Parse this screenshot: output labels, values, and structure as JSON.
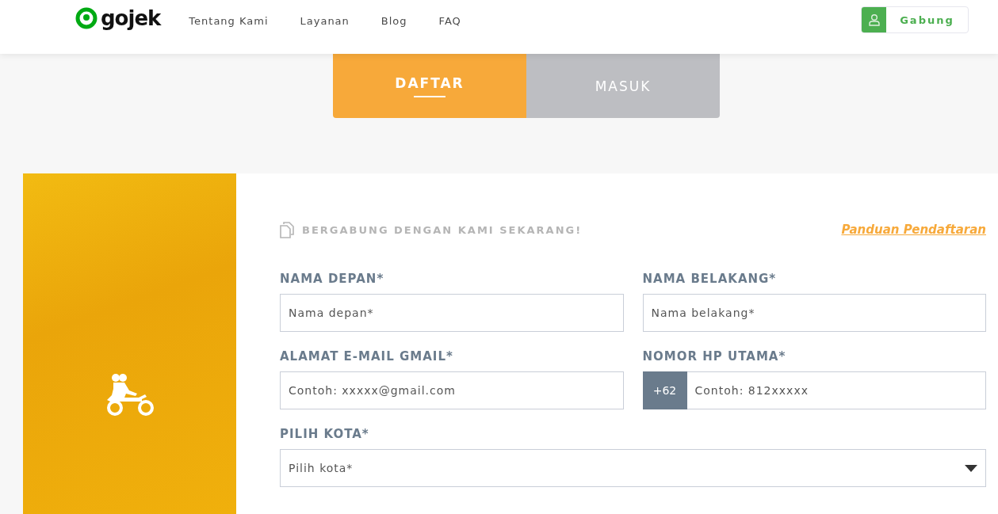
{
  "header": {
    "logo": "gojek",
    "nav": [
      "Tentang Kami",
      "Layanan",
      "Blog",
      "FAQ"
    ],
    "join_button": "Gabung"
  },
  "tabs": [
    {
      "label": "DAFTAR",
      "selected": true
    },
    {
      "label": "MASUK",
      "selected": false
    }
  ],
  "form": {
    "title": "BERGABUNG DENGAN KAMI SEKARANG!",
    "guide_link": "Panduan Pendaftaran",
    "rows": [
      [
        {
          "kind": "text",
          "label": "NAMA DEPAN*",
          "placeholder": "Nama depan*"
        },
        {
          "kind": "text",
          "label": "NAMA BELAKANG*",
          "placeholder": "Nama belakang*"
        }
      ],
      [
        {
          "kind": "text",
          "label": "ALAMAT E-MAIL GMAIL*",
          "placeholder": "Contoh: xxxxx@gmail.com"
        },
        {
          "kind": "phone",
          "label": "NOMOR HP UTAMA*",
          "prefix": "+62",
          "placeholder": "Contoh: 812xxxxx"
        }
      ],
      [
        {
          "kind": "select",
          "label": "PILIH KOTA*",
          "placeholder": "Pilih kota*"
        }
      ]
    ]
  }
}
